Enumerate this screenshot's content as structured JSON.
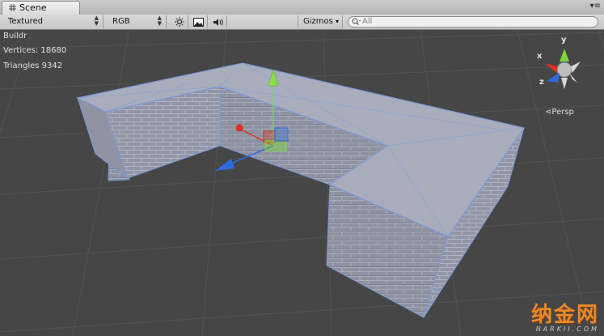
{
  "window": {
    "tab_label": "Scene",
    "menu_glyph": "▾≡"
  },
  "toolbar": {
    "render_mode": "Textured",
    "color_mode": "RGB",
    "gizmos_label": "Gizmos",
    "gizmos_arrow": "▾",
    "search_placeholder": "All",
    "updown_glyph": "⇕",
    "search_prefix": "▾",
    "icons": [
      "sun-icon",
      "image-icon",
      "speaker-icon"
    ]
  },
  "scene": {
    "object_name": "Buildr",
    "vertices": "Vertices: 18680",
    "triangles": "Triangles 9342",
    "projection": "Persp",
    "axis_x": "x",
    "axis_y": "y",
    "axis_z": "z",
    "watermark_main": "纳金网",
    "watermark_sub": "NARKII.COM",
    "colors": {
      "grid_bg": "#464646",
      "wall": "#8f93a2",
      "roof": "#a8adbb",
      "outline": "#7d99d8",
      "axis_y": "#7dd63b",
      "axis_x": "#d8331f",
      "axis_z": "#2f6be0"
    }
  }
}
